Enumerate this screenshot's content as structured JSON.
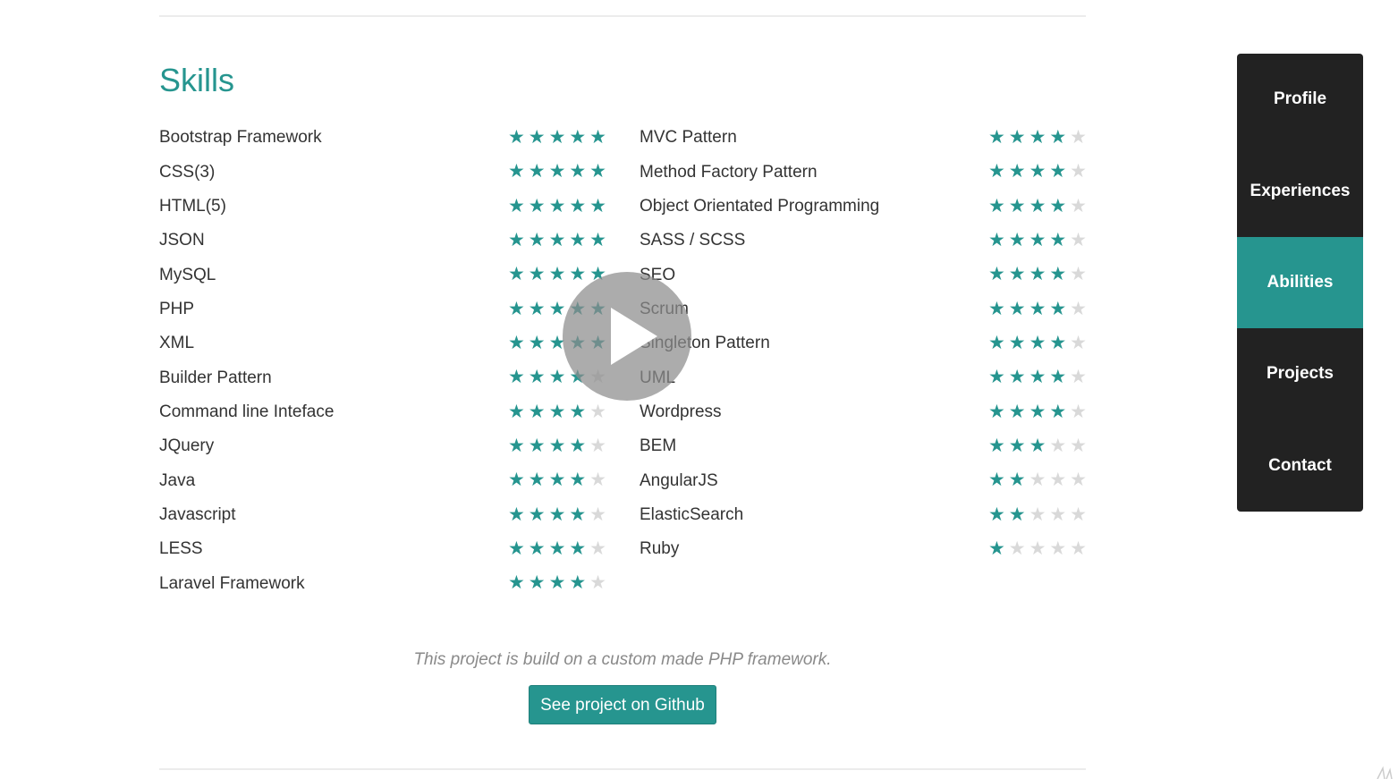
{
  "section_title": "Skills",
  "skills_left": [
    {
      "name": "Bootstrap Framework",
      "rating": 5
    },
    {
      "name": "CSS(3)",
      "rating": 5
    },
    {
      "name": "HTML(5)",
      "rating": 5
    },
    {
      "name": "JSON",
      "rating": 5
    },
    {
      "name": "MySQL",
      "rating": 5
    },
    {
      "name": "PHP",
      "rating": 5
    },
    {
      "name": "XML",
      "rating": 5
    },
    {
      "name": "Builder Pattern",
      "rating": 4
    },
    {
      "name": "Command line Inteface",
      "rating": 4
    },
    {
      "name": "JQuery",
      "rating": 4
    },
    {
      "name": "Java",
      "rating": 4
    },
    {
      "name": "Javascript",
      "rating": 4
    },
    {
      "name": "LESS",
      "rating": 4
    },
    {
      "name": "Laravel Framework",
      "rating": 4
    }
  ],
  "skills_right": [
    {
      "name": "MVC Pattern",
      "rating": 4
    },
    {
      "name": "Method Factory Pattern",
      "rating": 4
    },
    {
      "name": "Object Orientated Programming",
      "rating": 4
    },
    {
      "name": "SASS / SCSS",
      "rating": 4
    },
    {
      "name": "SEO",
      "rating": 4
    },
    {
      "name": "Scrum",
      "rating": 4
    },
    {
      "name": "Singleton Pattern",
      "rating": 4
    },
    {
      "name": "UML",
      "rating": 4
    },
    {
      "name": "Wordpress",
      "rating": 4
    },
    {
      "name": "BEM",
      "rating": 3
    },
    {
      "name": "AngularJS",
      "rating": 2
    },
    {
      "name": "ElasticSearch",
      "rating": 2
    },
    {
      "name": "Ruby",
      "rating": 1
    }
  ],
  "rating_max": 5,
  "footer_note": "This project is build on a custom made PHP framework.",
  "github_button_label": "See project on Github",
  "nav": {
    "items": [
      {
        "label": "Profile",
        "active": false
      },
      {
        "label": "Experiences",
        "active": false
      },
      {
        "label": "Abilities",
        "active": true
      },
      {
        "label": "Projects",
        "active": false
      },
      {
        "label": "Contact",
        "active": false
      }
    ]
  },
  "colors": {
    "accent": "#26958f",
    "star_off": "#d9d9d9",
    "nav_bg": "#222222"
  },
  "icons": {
    "play": "play-icon",
    "star": "star-icon"
  }
}
